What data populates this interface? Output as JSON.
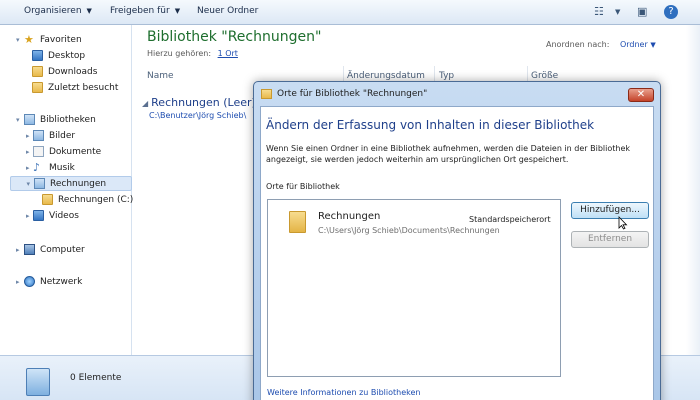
{
  "toolbar": {
    "organize": "Organisieren",
    "share": "Freigeben für",
    "new_folder": "Neuer Ordner"
  },
  "nav": {
    "favorites": "Favoriten",
    "desktop": "Desktop",
    "downloads": "Downloads",
    "recent": "Zuletzt besucht",
    "libraries": "Bibliotheken",
    "pictures": "Bilder",
    "documents": "Dokumente",
    "music": "Musik",
    "invoices": "Rechnungen",
    "invoices_c": "Rechnungen (C:)",
    "videos": "Videos",
    "computer": "Computer",
    "network": "Netzwerk"
  },
  "library": {
    "title": "Bibliothek \"Rechnungen\"",
    "includes_label": "Hierzu gehören:",
    "includes_link": "1 Ort",
    "arrange_label": "Anordnen nach:",
    "arrange_value": "Ordner"
  },
  "columns": {
    "name": "Name",
    "date": "Änderungsdatum",
    "type": "Typ",
    "size": "Größe"
  },
  "group": {
    "header": "Rechnungen (Leer)",
    "path": "C:\\Benutzer\\Jörg Schieb\\"
  },
  "details": {
    "count": "0 Elemente"
  },
  "dialog": {
    "title": "Orte für Bibliothek \"Rechnungen\"",
    "heading": "Ändern der Erfassung von Inhalten in dieser Bibliothek",
    "description": "Wenn Sie einen Ordner in eine Bibliothek aufnehmen, werden die Dateien in der Bibliothek angezeigt, sie werden jedoch weiterhin am ursprünglichen Ort gespeichert.",
    "locations_label": "Orte für Bibliothek",
    "location_name": "Rechnungen",
    "location_default": "Standardspeicherort",
    "location_path": "C:\\Users\\Jörg Schieb\\Documents\\Rechnungen",
    "add_button": "Hinzufügen...",
    "remove_button": "Entfernen",
    "more_info_link": "Weitere Informationen zu Bibliotheken"
  }
}
